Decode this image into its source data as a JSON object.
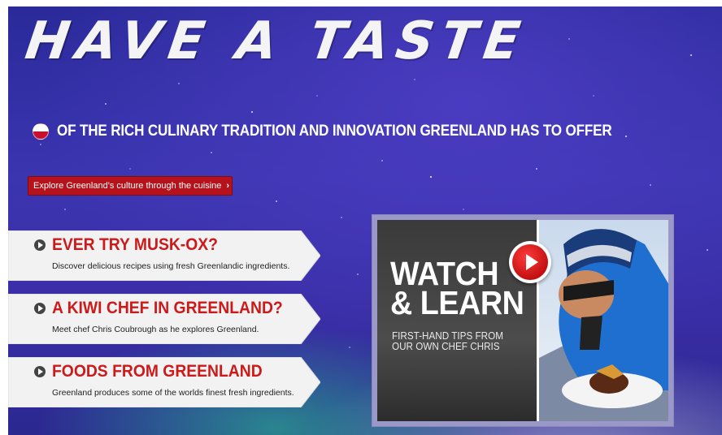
{
  "hero": {
    "headline": "HAVE A TASTE",
    "subline": "OF THE RICH CULINARY TRADITION AND INNOVATION GREENLAND HAS TO OFFER",
    "cta_label": "Explore Greenland's culture through the cuisine",
    "cta_chevron": "›"
  },
  "cards": [
    {
      "title": "EVER TRY MUSK-OX?",
      "description": "Discover delicious recipes using fresh Greenlandic ingredients."
    },
    {
      "title": "A KIWI CHEF IN GREENLAND?",
      "description": "Meet chef Chris Coubrough as he explores Greenland."
    },
    {
      "title": "FOODS FROM GREENLAND",
      "description": "Greenland produces some of the worlds finest fresh ingredients."
    }
  ],
  "video": {
    "heading": "WATCH\n& LEARN",
    "tagline": "FIRST-HAND TIPS FROM\nOUR OWN CHEF CHRIS"
  },
  "colors": {
    "accent_red": "#c8102e",
    "sky_blue": "#3b35b0"
  },
  "icons": {
    "play": "play-icon",
    "flag": "greenland-flag-icon"
  }
}
